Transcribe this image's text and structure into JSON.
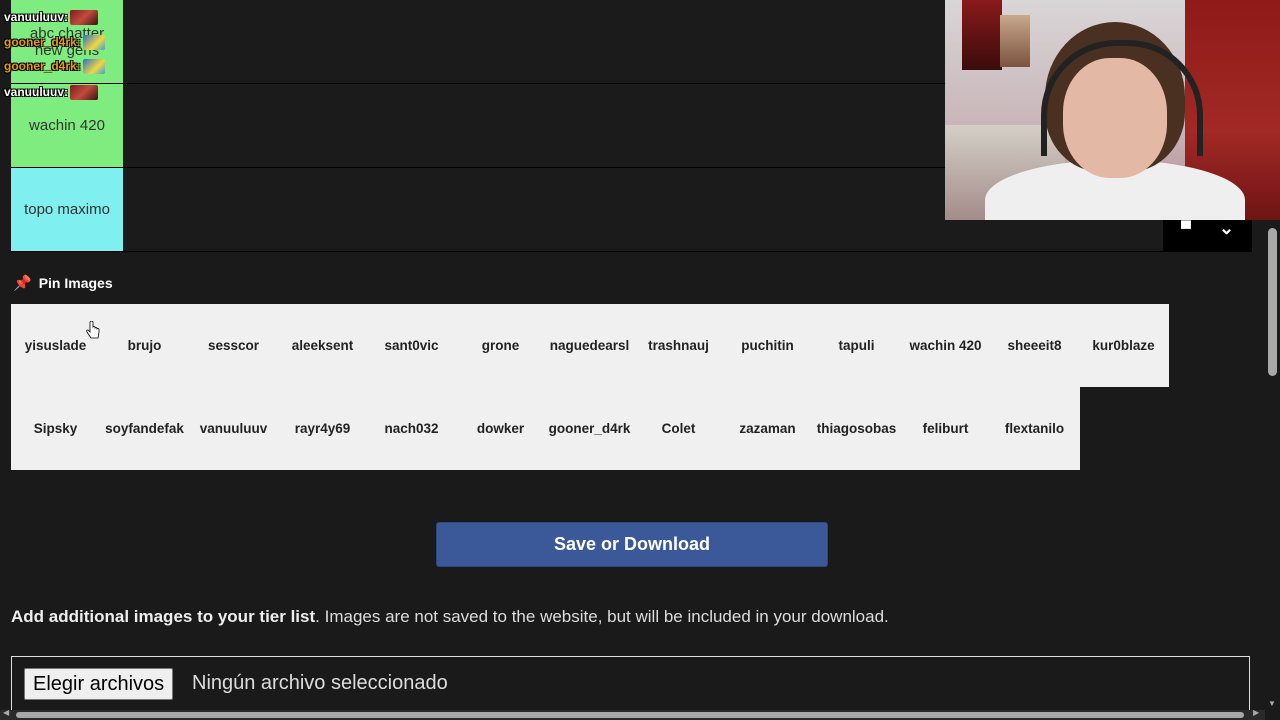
{
  "tiers": [
    {
      "label": "abc chatter\nnew gens",
      "color": "#7fec7f"
    },
    {
      "label": "wachin 420",
      "color": "#7fec7f"
    },
    {
      "label": "topo maximo",
      "color": "#7fefef"
    }
  ],
  "chat": [
    {
      "user": "vanuuluuv:",
      "color": "#ffffff",
      "emote": "red-emote"
    },
    {
      "user": "gooner_d4rk:",
      "color": "#e8a000",
      "emote": "blue-emote"
    },
    {
      "user": "gooner_d4rk:",
      "color": "#e8a000",
      "emote": "blue-emote"
    },
    {
      "user": "vanuuluuv:",
      "color": "#ffffff",
      "emote": "red-emote"
    }
  ],
  "pin": {
    "icon": "pushpin-icon",
    "label": "Pin Images"
  },
  "pool_row1": [
    "yisuslade",
    "brujo",
    "sesscor",
    "aleeksent",
    "sant0vic",
    "grone",
    "naguedearsl",
    "trashnauj",
    "puchitin",
    "tapuli",
    "wachin 420",
    "sheeeit8",
    "kur0blaze"
  ],
  "pool_row2": [
    "Sipsky",
    "soyfandefak",
    "vanuuluuv",
    "rayr4y69",
    "nach032",
    "dowker",
    "gooner_d4rk",
    "Colet",
    "zazaman",
    "thiagosobas",
    "feliburt",
    "flextanilo"
  ],
  "save_button": {
    "label": "Save or Download",
    "color": "#3b5998"
  },
  "info": {
    "bold": "Add additional images to your tier list",
    "rest": ". Images are not saved to the website, but will be included in your download."
  },
  "file_input": {
    "button": "Elegir archivos",
    "status": "Ningún archivo seleccionado"
  }
}
